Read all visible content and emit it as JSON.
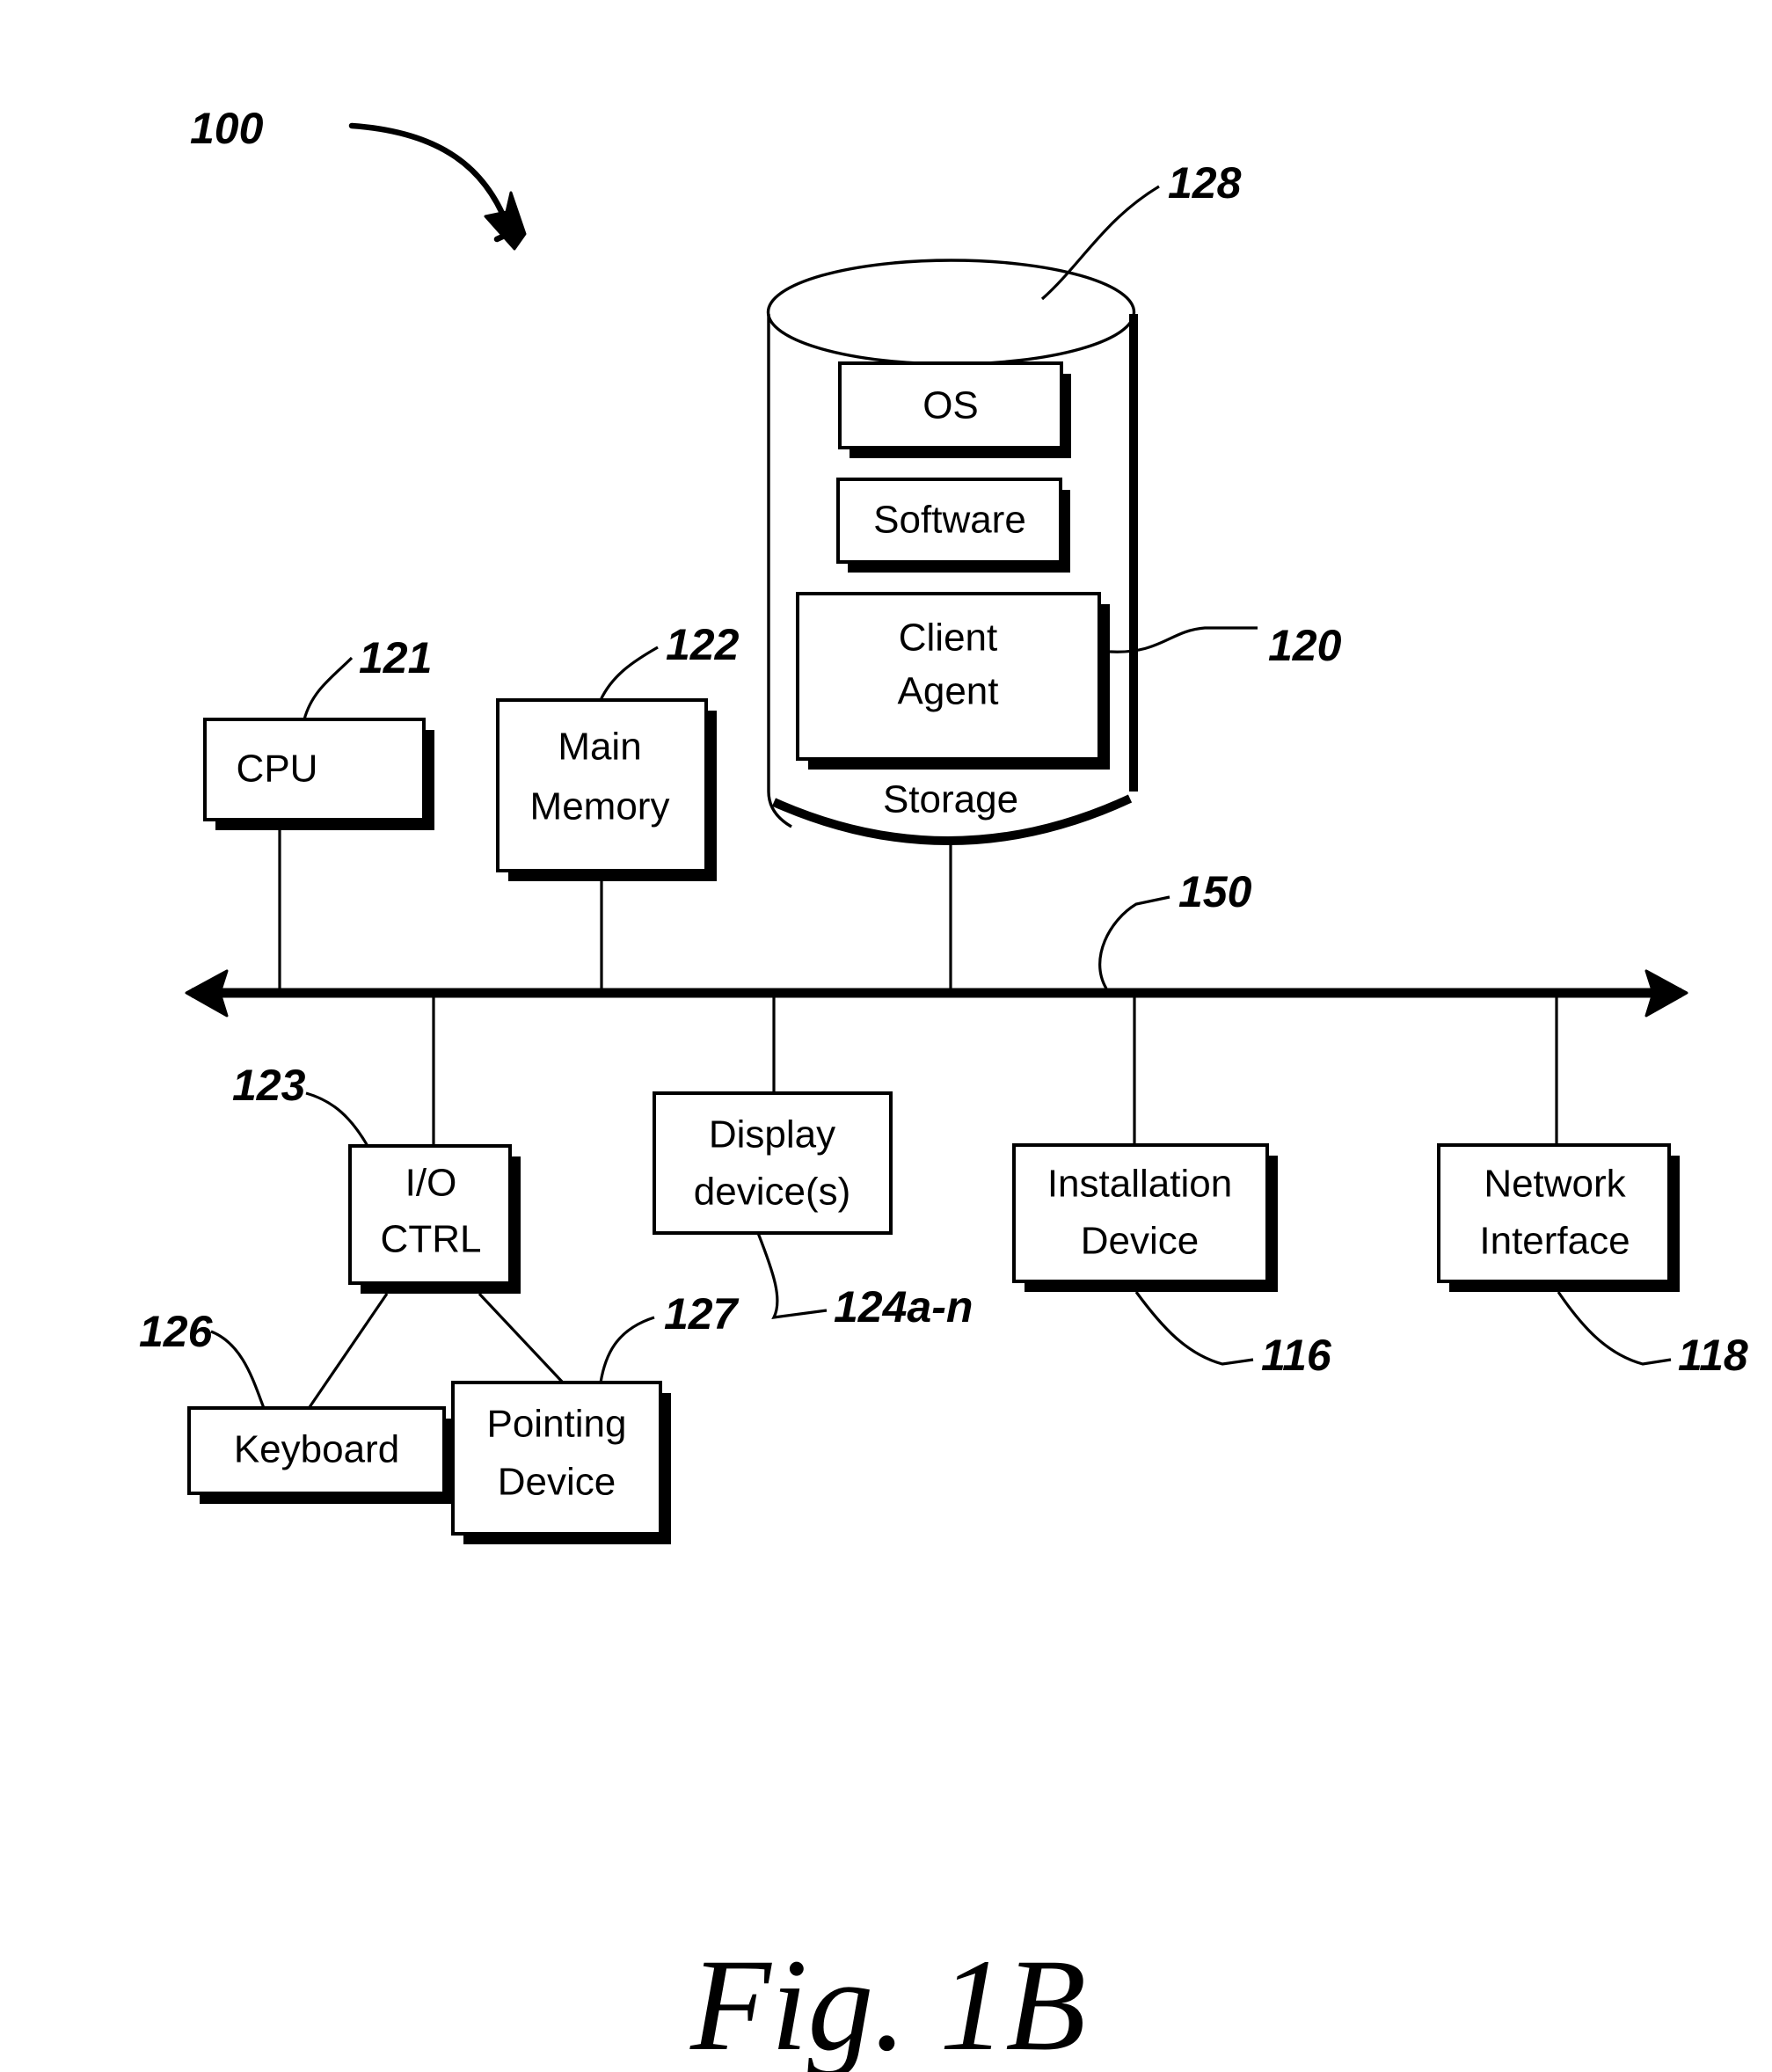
{
  "figure": {
    "caption": "Fig. 1B",
    "system_ref": "100"
  },
  "storage": {
    "label": "Storage",
    "ref": "128",
    "contents": [
      {
        "label": "OS",
        "ref": ""
      },
      {
        "label": "Software",
        "ref": ""
      },
      {
        "label": "Client\nAgent",
        "line1": "Client",
        "line2": "Agent",
        "ref": "120"
      }
    ]
  },
  "bus": {
    "ref": "150"
  },
  "components": {
    "cpu": {
      "label": "CPU",
      "ref": "121"
    },
    "main_memory": {
      "line1": "Main",
      "line2": "Memory",
      "ref": "122"
    },
    "io_ctrl": {
      "line1": "I/O",
      "line2": "CTRL",
      "ref": "123"
    },
    "display": {
      "line1": "Display",
      "line2": "device(s)",
      "ref": "124a-n"
    },
    "installation": {
      "line1": "Installation",
      "line2": "Device",
      "ref": "116"
    },
    "network": {
      "line1": "Network",
      "line2": "Interface",
      "ref": "118"
    },
    "keyboard": {
      "label": "Keyboard",
      "ref": "126"
    },
    "pointing": {
      "line1": "Pointing",
      "line2": "Device",
      "ref": "127"
    }
  },
  "colors": {
    "ink": "#000000",
    "paper": "#ffffff"
  }
}
